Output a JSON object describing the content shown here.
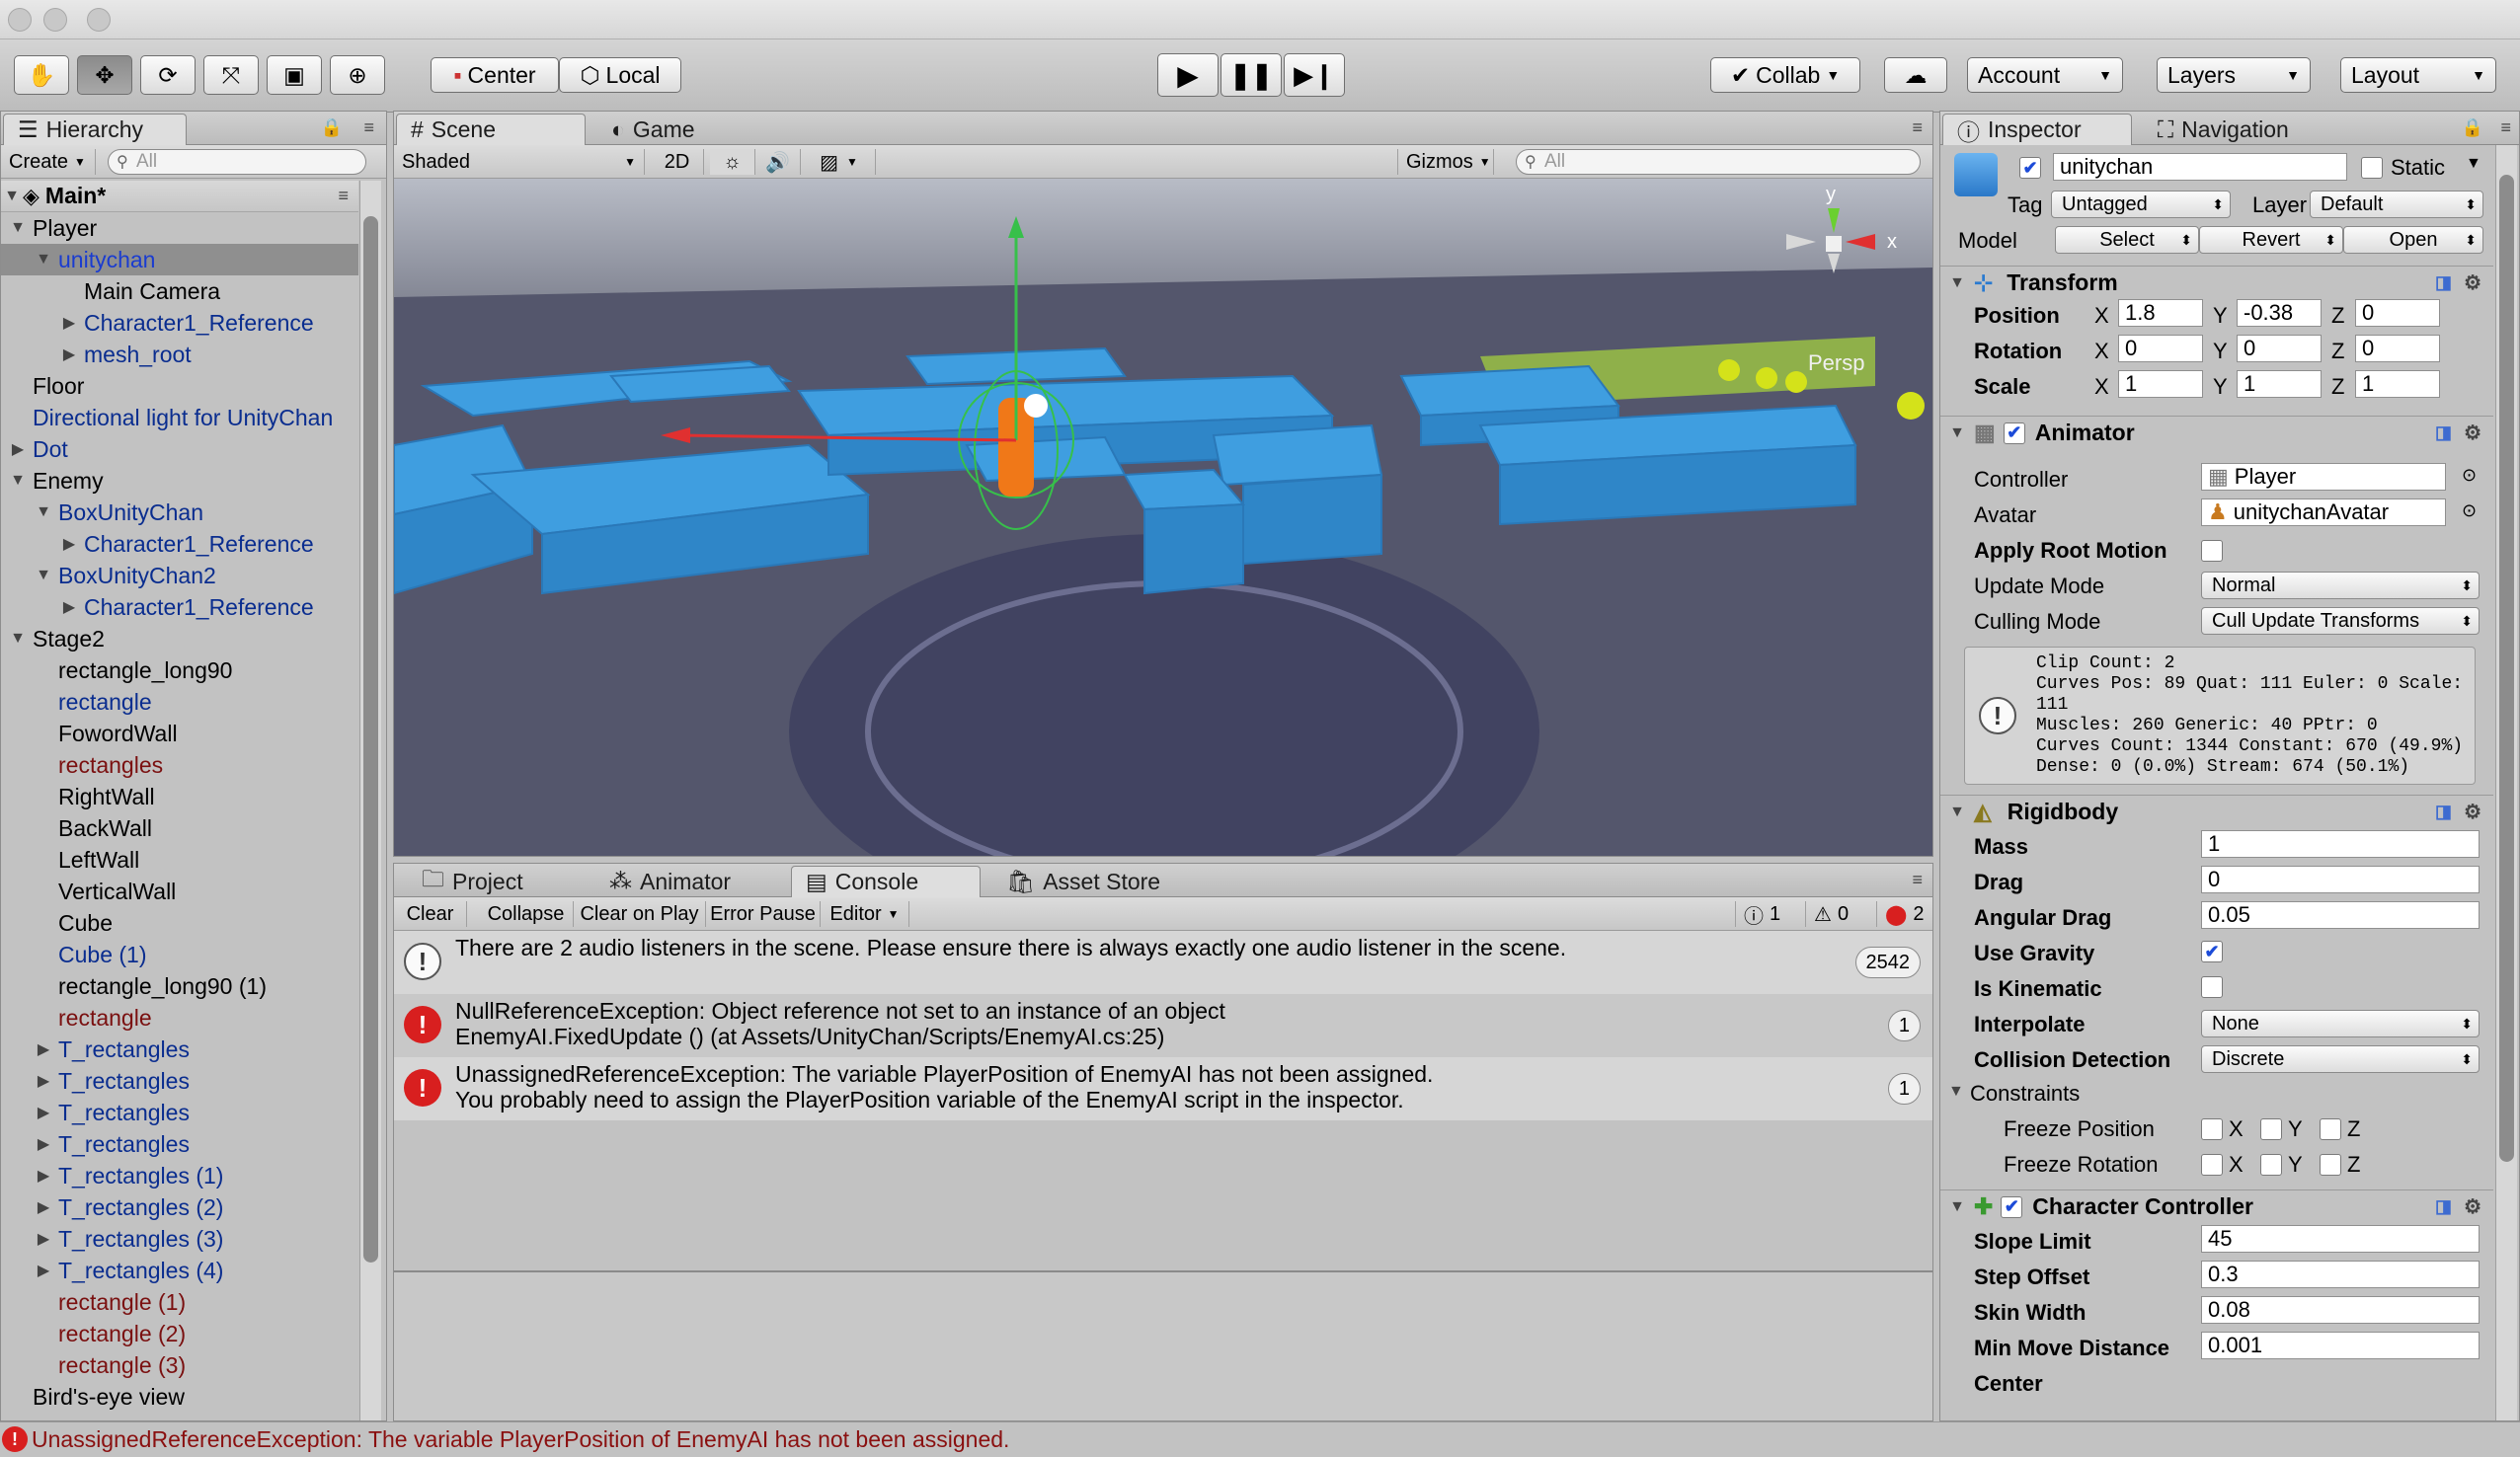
{
  "toolbar": {
    "center_label": "Center",
    "local_label": "Local",
    "collab_label": "Collab",
    "account_label": "Account",
    "layers_label": "Layers",
    "layout_label": "Layout"
  },
  "hierarchy": {
    "tab_label": "Hierarchy",
    "create_label": "Create",
    "search_placeholder": "All",
    "scene_name": "Main*",
    "rows": [
      {
        "label": "Player",
        "indent": 1,
        "arrow": "down",
        "color": "black"
      },
      {
        "label": "unitychan",
        "indent": 2,
        "arrow": "down",
        "color": "sel",
        "selected": true
      },
      {
        "label": "Main Camera",
        "indent": 3,
        "arrow": "",
        "color": "black"
      },
      {
        "label": "Character1_Reference",
        "indent": 3,
        "arrow": "right",
        "color": "blue"
      },
      {
        "label": "mesh_root",
        "indent": 3,
        "arrow": "right",
        "color": "blue"
      },
      {
        "label": "Floor",
        "indent": 1,
        "arrow": "",
        "color": "black"
      },
      {
        "label": "Directional light for UnityChan",
        "indent": 1,
        "arrow": "",
        "color": "blue"
      },
      {
        "label": "Dot",
        "indent": 1,
        "arrow": "right",
        "color": "blue"
      },
      {
        "label": "Enemy",
        "indent": 1,
        "arrow": "down",
        "color": "black"
      },
      {
        "label": "BoxUnityChan",
        "indent": 2,
        "arrow": "down",
        "color": "blue"
      },
      {
        "label": "Character1_Reference",
        "indent": 3,
        "arrow": "right",
        "color": "blue"
      },
      {
        "label": "BoxUnityChan2",
        "indent": 2,
        "arrow": "down",
        "color": "blue"
      },
      {
        "label": "Character1_Reference",
        "indent": 3,
        "arrow": "right",
        "color": "blue"
      },
      {
        "label": "Stage2",
        "indent": 1,
        "arrow": "down",
        "color": "black"
      },
      {
        "label": "rectangle_long90",
        "indent": 2,
        "arrow": "",
        "color": "black"
      },
      {
        "label": "rectangle",
        "indent": 2,
        "arrow": "",
        "color": "blue"
      },
      {
        "label": "FowordWall",
        "indent": 2,
        "arrow": "",
        "color": "black"
      },
      {
        "label": "rectangles",
        "indent": 2,
        "arrow": "",
        "color": "red"
      },
      {
        "label": "RightWall",
        "indent": 2,
        "arrow": "",
        "color": "black"
      },
      {
        "label": "BackWall",
        "indent": 2,
        "arrow": "",
        "color": "black"
      },
      {
        "label": "LeftWall",
        "indent": 2,
        "arrow": "",
        "color": "black"
      },
      {
        "label": "VerticalWall",
        "indent": 2,
        "arrow": "",
        "color": "black"
      },
      {
        "label": "Cube",
        "indent": 2,
        "arrow": "",
        "color": "black"
      },
      {
        "label": "Cube (1)",
        "indent": 2,
        "arrow": "",
        "color": "blue"
      },
      {
        "label": "rectangle_long90 (1)",
        "indent": 2,
        "arrow": "",
        "color": "black"
      },
      {
        "label": "rectangle",
        "indent": 2,
        "arrow": "",
        "color": "red"
      },
      {
        "label": "T_rectangles",
        "indent": 2,
        "arrow": "right",
        "color": "blue"
      },
      {
        "label": "T_rectangles",
        "indent": 2,
        "arrow": "right",
        "color": "blue"
      },
      {
        "label": "T_rectangles",
        "indent": 2,
        "arrow": "right",
        "color": "blue"
      },
      {
        "label": "T_rectangles",
        "indent": 2,
        "arrow": "right",
        "color": "blue"
      },
      {
        "label": "T_rectangles (1)",
        "indent": 2,
        "arrow": "right",
        "color": "blue"
      },
      {
        "label": "T_rectangles (2)",
        "indent": 2,
        "arrow": "right",
        "color": "blue"
      },
      {
        "label": "T_rectangles (3)",
        "indent": 2,
        "arrow": "right",
        "color": "blue"
      },
      {
        "label": "T_rectangles (4)",
        "indent": 2,
        "arrow": "right",
        "color": "blue"
      },
      {
        "label": "rectangle (1)",
        "indent": 2,
        "arrow": "",
        "color": "red"
      },
      {
        "label": "rectangle (2)",
        "indent": 2,
        "arrow": "",
        "color": "red"
      },
      {
        "label": "rectangle (3)",
        "indent": 2,
        "arrow": "",
        "color": "red"
      },
      {
        "label": "Bird's-eye view",
        "indent": 1,
        "arrow": "",
        "color": "black"
      }
    ]
  },
  "scene": {
    "tab_scene": "Scene",
    "tab_game": "Game",
    "shading_mode": "Shaded",
    "mode_2d": "2D",
    "gizmos_label": "Gizmos",
    "search_placeholder": "All",
    "persp_label": "Persp"
  },
  "bottom": {
    "tabs": [
      "Project",
      "Animator",
      "Console",
      "Asset Store"
    ],
    "console_buttons": [
      "Clear",
      "Collapse",
      "Clear on Play",
      "Error Pause",
      "Editor"
    ],
    "count_info": "1",
    "count_warn": "0",
    "count_error": "2",
    "messages": [
      {
        "type": "warning",
        "line1": "There are 2 audio listeners in the scene. Please ensure there is always exactly one audio listener in the scene.",
        "line2": "",
        "count": "2542"
      },
      {
        "type": "error",
        "line1": "NullReferenceException: Object reference not set to an instance of an object",
        "line2": "EnemyAI.FixedUpdate () (at Assets/UnityChan/Scripts/EnemyAI.cs:25)",
        "count": "1"
      },
      {
        "type": "error",
        "line1": "UnassignedReferenceException: The variable PlayerPosition of EnemyAI has not been assigned.",
        "line2": "You probably need to assign the PlayerPosition variable of the EnemyAI script in the inspector.",
        "count": "1"
      }
    ]
  },
  "inspector": {
    "tab_inspector": "Inspector",
    "tab_navigation": "Navigation",
    "object_name": "unitychan",
    "static_label": "Static",
    "tag_label": "Tag",
    "tag_value": "Untagged",
    "layer_label": "Layer",
    "layer_value": "Default",
    "model_label": "Model",
    "model_select": "Select",
    "model_revert": "Revert",
    "model_open": "Open",
    "transform": {
      "title": "Transform",
      "position_label": "Position",
      "position": [
        "1.8",
        "-0.38",
        "0"
      ],
      "rotation_label": "Rotation",
      "rotation": [
        "0",
        "0",
        "0"
      ],
      "scale_label": "Scale",
      "scale": [
        "1",
        "1",
        "1"
      ],
      "x": "X",
      "y": "Y",
      "z": "Z"
    },
    "animator": {
      "title": "Animator",
      "controller_label": "Controller",
      "controller_value": "Player",
      "avatar_label": "Avatar",
      "avatar_value": "unitychanAvatar",
      "root_motion_label": "Apply Root Motion",
      "update_mode_label": "Update Mode",
      "update_mode_value": "Normal",
      "culling_mode_label": "Culling Mode",
      "culling_mode_value": "Cull Update Transforms",
      "info_lines": [
        "Clip Count: 2",
        "Curves Pos: 89 Quat: 111 Euler: 0 Scale: 111",
        "Muscles: 260 Generic: 40 PPtr: 0",
        "Curves Count: 1344 Constant: 670 (49.9%)",
        "Dense: 0 (0.0%) Stream: 674 (50.1%)"
      ]
    },
    "rigidbody": {
      "title": "Rigidbody",
      "mass_label": "Mass",
      "mass": "1",
      "drag_label": "Drag",
      "drag": "0",
      "angular_drag_label": "Angular Drag",
      "angular_drag": "0.05",
      "use_gravity_label": "Use Gravity",
      "is_kinematic_label": "Is Kinematic",
      "interpolate_label": "Interpolate",
      "interpolate": "None",
      "collision_label": "Collision Detection",
      "collision": "Discrete",
      "constraints_label": "Constraints",
      "freeze_pos_label": "Freeze Position",
      "freeze_rot_label": "Freeze Rotation"
    },
    "character_controller": {
      "title": "Character Controller",
      "slope_label": "Slope Limit",
      "slope": "45",
      "step_label": "Step Offset",
      "step": "0.3",
      "skin_label": "Skin Width",
      "skin": "0.08",
      "min_move_label": "Min Move Distance",
      "min_move": "0.001",
      "center_label": "Center"
    }
  },
  "status": {
    "message": "UnassignedReferenceException: The variable PlayerPosition of EnemyAI has not been assigned."
  },
  "colors": {
    "wall_blue": "#3f9ee0",
    "error_red": "#d81f1f",
    "selection": "#8f8f8f"
  }
}
